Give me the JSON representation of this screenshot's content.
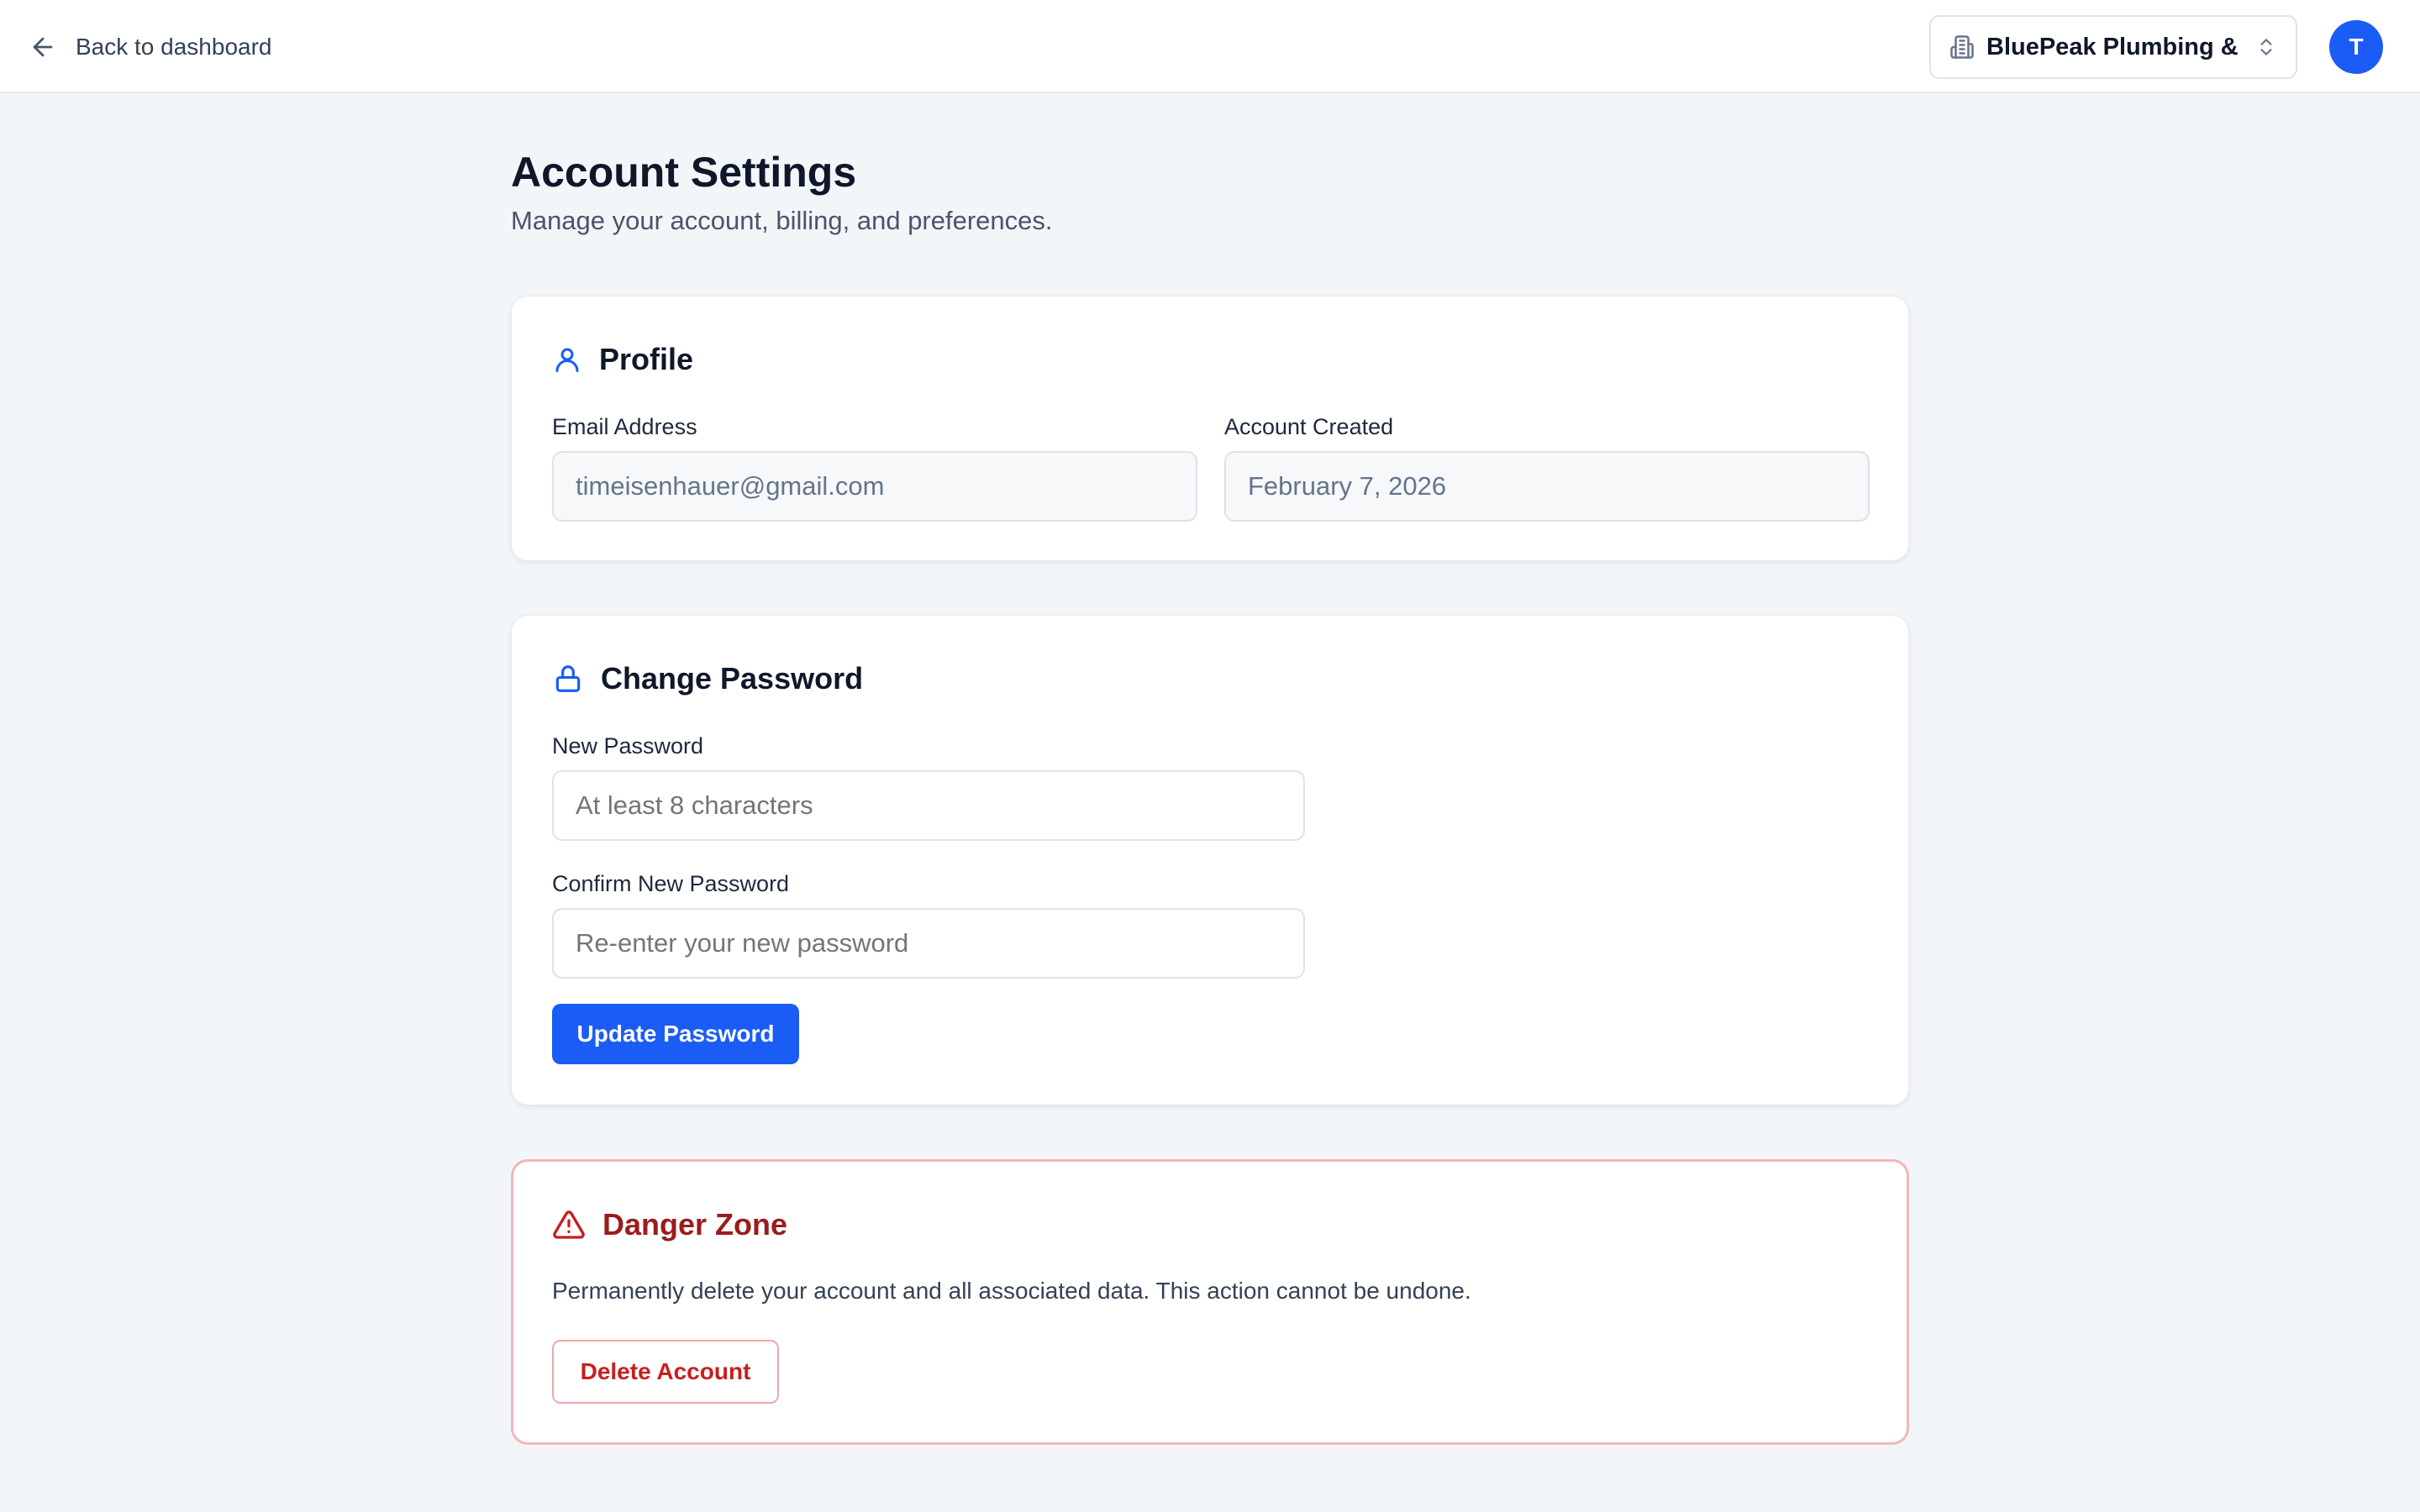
{
  "topbar": {
    "back_label": "Back to dashboard",
    "org_name": "BluePeak Plumbing & ...",
    "avatar_initial": "T"
  },
  "page": {
    "title": "Account Settings",
    "subtitle": "Manage your account, billing, and preferences."
  },
  "profile": {
    "title": "Profile",
    "email_label": "Email Address",
    "email_value": "timeisenhauer@gmail.com",
    "created_label": "Account Created",
    "created_value": "February 7, 2026"
  },
  "password": {
    "title": "Change Password",
    "new_label": "New Password",
    "new_placeholder": "At least 8 characters",
    "confirm_label": "Confirm New Password",
    "confirm_placeholder": "Re-enter your new password",
    "submit_label": "Update Password"
  },
  "danger": {
    "title": "Danger Zone",
    "description": "Permanently delete your account and all associated data. This action cannot be undone.",
    "delete_label": "Delete Account"
  },
  "colors": {
    "accent": "#1a5cf5",
    "danger": "#c81e1e",
    "danger_title": "#9b1c1c",
    "danger_border": "#f5b5b8",
    "page_bg": "#f3f6f9"
  },
  "icons": {
    "back": "arrow-left-icon",
    "org": "building-icon",
    "org_toggle": "chevron-up-down-icon",
    "profile": "user-icon",
    "password": "lock-icon",
    "danger": "warning-triangle-icon"
  }
}
